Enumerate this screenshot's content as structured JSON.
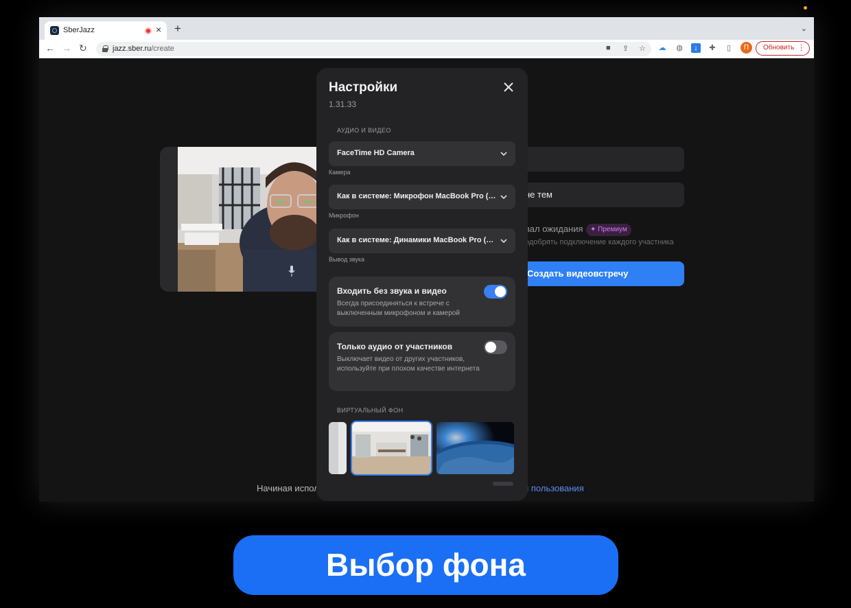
{
  "browser": {
    "tab": {
      "title": "SberJazz"
    },
    "url": {
      "host": "jazz.sber.ru",
      "path": "/create"
    },
    "profile_initial": "П",
    "update_label": "Обновить"
  },
  "page": {
    "field_2_partial": "не тем",
    "waiting_partial": "вал ожидания",
    "premium_label": "✦ Премиум",
    "waiting_sub_partial": "одобрять подключение каждого участника",
    "create_button": "Создать видеовстречу",
    "footer_left_partial": "Начиная испол",
    "footer_link_partial": "и пользования"
  },
  "settings": {
    "title": "Настройки",
    "version": "1.31.33",
    "audio_video_label": "АУДИО И ВИДЕО",
    "camera": {
      "value": "FaceTime HD Camera",
      "caption": "Камера"
    },
    "microphone": {
      "value": "Как в системе: Микрофон MacBook Pro (Встроенный)",
      "caption": "Микрофон"
    },
    "speaker": {
      "value": "Как в системе: Динамики MacBook Pro (Встроенный)",
      "caption": "Вывод звука"
    },
    "join_muted": {
      "title": "Входить без звука и видео",
      "description": "Всегда присоединяться к встрече с выключенным микрофоном и камерой",
      "enabled": true
    },
    "audio_only": {
      "title": "Только аудио от участников",
      "description": "Выключает видео от других участников, используйте при плохом качестве интернета",
      "enabled": false
    },
    "virtual_bg_label": "ВИРТУАЛЬНЫЙ ФОН",
    "backgrounds": [
      {
        "name": "white-wall",
        "selected": false
      },
      {
        "name": "office",
        "selected": true
      },
      {
        "name": "earth-from-space",
        "selected": false
      }
    ]
  },
  "banner": {
    "text": "Выбор фона"
  },
  "colors": {
    "accent": "#3a7ff2",
    "banner": "#1a6ff5",
    "premium": "#d477ff"
  }
}
